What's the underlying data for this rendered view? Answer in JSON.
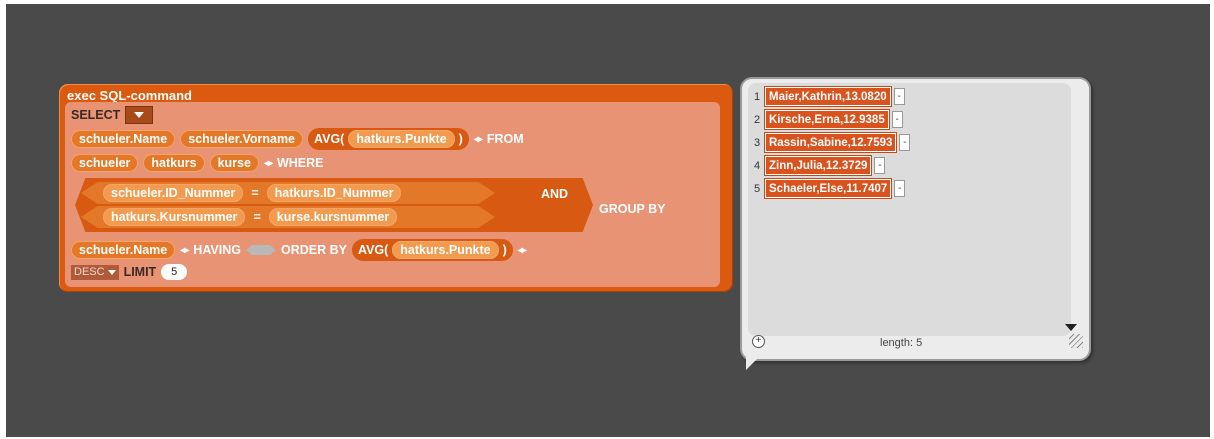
{
  "block": {
    "title": "exec SQL-command",
    "select": "SELECT",
    "select_fields": [
      "schueler.Name",
      "schueler.Vorname"
    ],
    "avg_label": "AVG(",
    "avg_field": "hatkurs.Punkte",
    "close_paren": ")",
    "from": "FROM",
    "from_tables": [
      "schueler",
      "hatkurs",
      "kurse"
    ],
    "where": "WHERE",
    "cond1_left": "schueler.ID_Nummer",
    "cond1_op": "=",
    "cond1_right": "hatkurs.ID_Nummer",
    "cond2_left": "hatkurs.Kursnummer",
    "cond2_op": "=",
    "cond2_right": "kurse.kursnummer",
    "and": "AND",
    "group_by": "GROUP BY",
    "group_field": "schueler.Name",
    "having": "HAVING",
    "order_by": "ORDER BY",
    "order_avg": "AVG(",
    "order_field": "hatkurs.Punkte",
    "order_dir": "DESC",
    "limit": "LIMIT",
    "limit_value": "5"
  },
  "result": {
    "items": [
      {
        "index": "1",
        "value": "Maier,Kathrin,13.0820"
      },
      {
        "index": "2",
        "value": "Kirsche,Erna,12.9385"
      },
      {
        "index": "3",
        "value": "Rassin,Sabine,12.7593"
      },
      {
        "index": "4",
        "value": "Zinn,Julia,12.3729"
      },
      {
        "index": "5",
        "value": "Schaeler,Else,11.7407"
      }
    ],
    "length_label": "length: 5",
    "minus": "-",
    "plus": "+"
  },
  "icons": {
    "arrows": "◂▸"
  }
}
